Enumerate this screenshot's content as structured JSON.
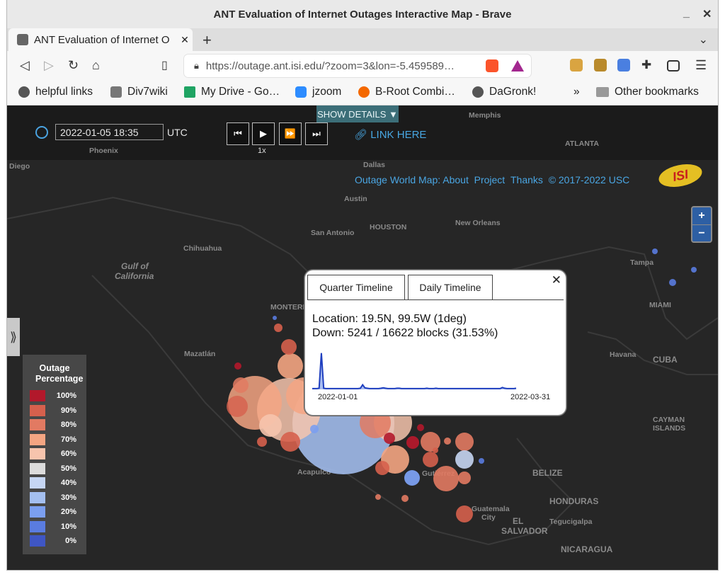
{
  "window": {
    "title": "ANT Evaluation of Internet Outages Interactive Map - Brave"
  },
  "tab": {
    "title": "ANT Evaluation of Internet O"
  },
  "toolbar": {
    "url": "https://outage.ant.isi.edu/?zoom=3&lon=-5.459589…"
  },
  "bookmarks": [
    {
      "label": "helpful links",
      "color": "#555555"
    },
    {
      "label": "Div7wiki",
      "color": "#777777"
    },
    {
      "label": "My Drive - Go…",
      "color": "#1fa463"
    },
    {
      "label": "jzoom",
      "color": "#2d8cff"
    },
    {
      "label": "B-Root Combi…",
      "color": "#f46800"
    },
    {
      "label": "DaGronk!",
      "color": "#555555"
    }
  ],
  "bookmarks_other": "Other bookmarks",
  "controls": {
    "show_details": "SHOW DETAILS ▼",
    "datetime": "2022-01-05 18:35",
    "timezone": "UTC",
    "speed": "1x",
    "link_here": "LINK HERE"
  },
  "credits": {
    "prefix": "Outage World Map: ",
    "about": "About",
    "project": "Project",
    "thanks": "Thanks",
    "copyright": "© 2017-2022 USC"
  },
  "logo": "ISI",
  "zoom": {
    "in": "+",
    "out": "−"
  },
  "map_labels": [
    {
      "text": "Memphis"
    },
    {
      "text": "ATLANTA"
    },
    {
      "text": "Phoenix"
    },
    {
      "text": "Diego"
    },
    {
      "text": "Dallas"
    },
    {
      "text": "Austin"
    },
    {
      "text": "San Antonio"
    },
    {
      "text": "HOUSTON"
    },
    {
      "text": "New Orleans"
    },
    {
      "text": "Tampa"
    },
    {
      "text": "Chihuahua"
    },
    {
      "text": "Gulf of"
    },
    {
      "text": "California"
    },
    {
      "text": "MONTERREY"
    },
    {
      "text": "MIAMI"
    },
    {
      "text": "Mazatlán"
    },
    {
      "text": "Havana"
    },
    {
      "text": "CUBA"
    },
    {
      "text": "CAYMAN"
    },
    {
      "text": "ISLANDS"
    },
    {
      "text": "Acapulco"
    },
    {
      "text": "BELIZE"
    },
    {
      "text": "HONDURAS"
    },
    {
      "text": "Guatemala"
    },
    {
      "text": "City"
    },
    {
      "text": "EL"
    },
    {
      "text": "SALVADOR"
    },
    {
      "text": "Tegucigalpa"
    },
    {
      "text": "NICARAGUA"
    },
    {
      "text": "Gutiérrez"
    }
  ],
  "legend": {
    "title": "Outage Percentage",
    "items": [
      {
        "label": "100%",
        "color": "#b2182b"
      },
      {
        "label": "90%",
        "color": "#d6604d"
      },
      {
        "label": "80%",
        "color": "#e27a62"
      },
      {
        "label": "70%",
        "color": "#f4a582"
      },
      {
        "label": "60%",
        "color": "#f6c4ad"
      },
      {
        "label": "50%",
        "color": "#dcdcdc"
      },
      {
        "label": "40%",
        "color": "#c6d6f3"
      },
      {
        "label": "30%",
        "color": "#a4bff0"
      },
      {
        "label": "20%",
        "color": "#7b9ff0"
      },
      {
        "label": "10%",
        "color": "#5a7ce0"
      },
      {
        "label": "0%",
        "color": "#3f56c4"
      }
    ]
  },
  "popup": {
    "tab_quarter": "Quarter Timeline",
    "tab_daily": "Daily Timeline",
    "close": "✕",
    "location": "Location: 19.5N, 99.5W (1deg)",
    "down": "Down: 5241 / 16622 blocks (31.53%)",
    "chart_start": "2022-01-01",
    "chart_end": "2022-03-31"
  },
  "chart_data": {
    "type": "line",
    "x_start": "2022-01-01",
    "x_end": "2022-03-31",
    "values": [
      2,
      2,
      2,
      3,
      95,
      3,
      2,
      2,
      2,
      2,
      2,
      2,
      2,
      2,
      2,
      2,
      2,
      2,
      2,
      2,
      2,
      3,
      12,
      4,
      3,
      2,
      2,
      2,
      2,
      2,
      3,
      4,
      3,
      2,
      2,
      2,
      2,
      3,
      3,
      2,
      2,
      2,
      2,
      2,
      2,
      2,
      2,
      2,
      2,
      2,
      3,
      2,
      2,
      2,
      3,
      2,
      2,
      2,
      2,
      2,
      2,
      2,
      2,
      2,
      2,
      2,
      2,
      2,
      2,
      2,
      2,
      2,
      2,
      2,
      2,
      2,
      2,
      2,
      2,
      2,
      2,
      2,
      2,
      5,
      3,
      2,
      2,
      2,
      2,
      3
    ],
    "series_color": "#1f3fbf",
    "fill_color": "#a9bdf0"
  }
}
